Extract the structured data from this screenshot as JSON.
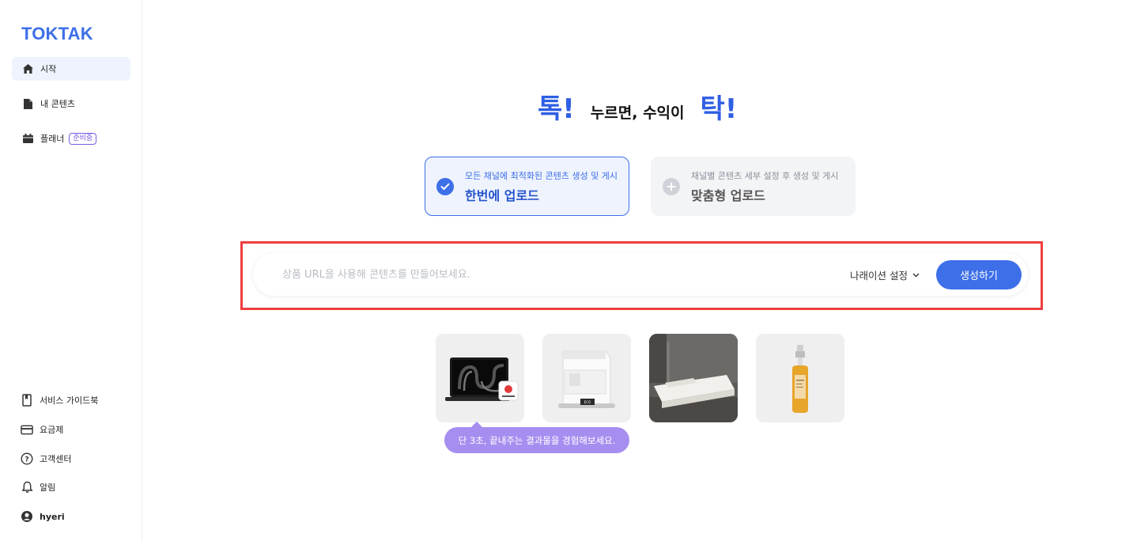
{
  "app": {
    "logo": "TOKTAK"
  },
  "sidebar": {
    "items": [
      {
        "label": "시작",
        "icon": "home-icon",
        "active": true
      },
      {
        "label": "내 콘텐츠",
        "icon": "document-icon",
        "active": false
      },
      {
        "label": "플래너",
        "icon": "calendar-icon",
        "active": false,
        "badge": "준비중"
      }
    ],
    "bottom": [
      {
        "label": "서비스 가이드북",
        "icon": "book-icon"
      },
      {
        "label": "요금제",
        "icon": "credit-card-icon"
      },
      {
        "label": "고객센터",
        "icon": "help-icon"
      },
      {
        "label": "알림",
        "icon": "bell-icon"
      },
      {
        "label": "hyeri",
        "icon": "user-icon"
      }
    ]
  },
  "headline": {
    "word1": "톡!",
    "middle": "누르면, 수익이",
    "word2": "탁!"
  },
  "modes": [
    {
      "sub": "모든 채널에 최적화된 콘텐츠 생성 및 게시",
      "title": "한번에 업로드",
      "selected": true
    },
    {
      "sub": "채널별 콘텐츠 세부 설정 후 생성 및 게시",
      "title": "맞춤형 업로드",
      "selected": false
    }
  ],
  "search": {
    "value": "",
    "placeholder": "상품 URL을 사용해 콘텐츠를 만들어보세요.",
    "narration_label": "나래이션 설정",
    "generate_label": "생성하기"
  },
  "tooltip": "단 3초, 끝내주는 결과물을 경험해보세요.",
  "colors": {
    "brand": "#3d6fe8",
    "highlight": "#ef3e3e",
    "tooltip": "#a68ef0",
    "selected_bg": "#eef3fd"
  }
}
